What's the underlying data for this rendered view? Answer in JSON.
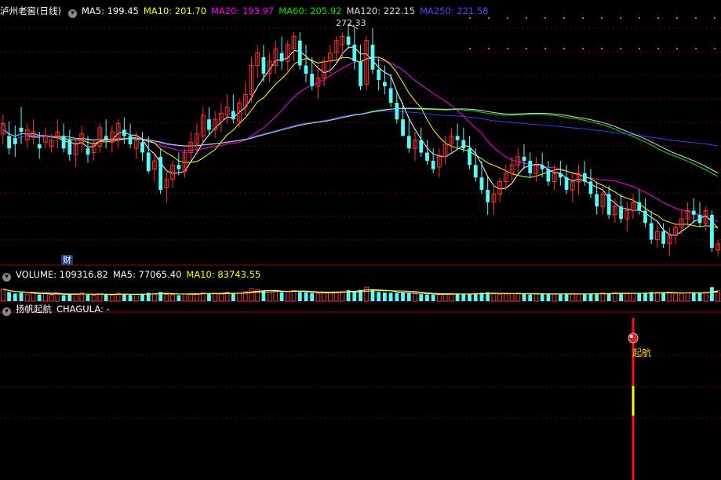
{
  "colors": {
    "up": "#ff3232",
    "down": "#54fcfc",
    "ma5": "#ffffff",
    "ma10": "#ffff00",
    "ma20": "#ff00ff",
    "ma60": "#00e600",
    "ma120": "#d8d8d8",
    "ma250": "#3a3aff",
    "grid": "#7a0000",
    "separator": "#b00000"
  },
  "price_header": {
    "title": "泸州老窖(日线)",
    "ma5": "MA5: 199.45",
    "ma10": "MA10: 201.70",
    "ma20": "MA20: 193.97",
    "ma60": "MA60: 205.92",
    "ma120": "MA120: 222.15",
    "ma250": "MA250: 221.58"
  },
  "high_label": "272.33",
  "finance_badge": "财",
  "volume_header": {
    "label": "VOLUME: 109316.82",
    "ma5": "MA5: 77065.40",
    "ma10": "MA10: 83743.55"
  },
  "indicator_header": {
    "label": "扬帆起航",
    "value": "CHAGULA: -"
  },
  "signal_label": "起航",
  "chart_data": {
    "type": "candlestick",
    "title": "泸州老窖(日线)",
    "price_range": [
      158,
      276
    ],
    "volume_range": [
      0,
      160000
    ],
    "grid": true,
    "candles_ohlc": [
      [
        219,
        228,
        214,
        224
      ],
      [
        218,
        225,
        209,
        212
      ],
      [
        217,
        223,
        208,
        214
      ],
      [
        222,
        232,
        214,
        220
      ],
      [
        216,
        224,
        212,
        221
      ],
      [
        218,
        226,
        214,
        220
      ],
      [
        214,
        220,
        207,
        212
      ],
      [
        215,
        222,
        212,
        218
      ],
      [
        213,
        219,
        210,
        216
      ],
      [
        217,
        226,
        212,
        220
      ],
      [
        218,
        224,
        210,
        212
      ],
      [
        216,
        221,
        206,
        209
      ],
      [
        209,
        217,
        203,
        214
      ],
      [
        215,
        223,
        210,
        219
      ],
      [
        212,
        218,
        205,
        209
      ],
      [
        210,
        216,
        206,
        214
      ],
      [
        213,
        224,
        210,
        222
      ],
      [
        218,
        226,
        212,
        216
      ],
      [
        215,
        223,
        210,
        220
      ],
      [
        216,
        226,
        212,
        224
      ],
      [
        221,
        227,
        214,
        218
      ],
      [
        218,
        224,
        212,
        214
      ],
      [
        212,
        220,
        207,
        216
      ],
      [
        215,
        220,
        206,
        210
      ],
      [
        210,
        218,
        200,
        201
      ],
      [
        202,
        209,
        196,
        206
      ],
      [
        208,
        212,
        190,
        192
      ],
      [
        193,
        202,
        186,
        197
      ],
      [
        197,
        206,
        193,
        204
      ],
      [
        204,
        210,
        199,
        202
      ],
      [
        201,
        212,
        198,
        210
      ],
      [
        210,
        220,
        206,
        215
      ],
      [
        214,
        224,
        209,
        219
      ],
      [
        218,
        232,
        215,
        228
      ],
      [
        226,
        232,
        218,
        221
      ],
      [
        221,
        230,
        217,
        226
      ],
      [
        225,
        234,
        220,
        229
      ],
      [
        228,
        238,
        224,
        232
      ],
      [
        230,
        238,
        224,
        226
      ],
      [
        225,
        236,
        222,
        234
      ],
      [
        232,
        244,
        228,
        238
      ],
      [
        238,
        256,
        234,
        252
      ],
      [
        252,
        262,
        246,
        258
      ],
      [
        256,
        262,
        244,
        248
      ],
      [
        248,
        258,
        244,
        254
      ],
      [
        252,
        264,
        248,
        260
      ],
      [
        258,
        266,
        250,
        254
      ],
      [
        254,
        264,
        248,
        262
      ],
      [
        260,
        268,
        254,
        266
      ],
      [
        264,
        268,
        250,
        252
      ],
      [
        252,
        262,
        244,
        248
      ],
      [
        248,
        256,
        240,
        242
      ],
      [
        242,
        252,
        236,
        246
      ],
      [
        246,
        256,
        242,
        254
      ],
      [
        254,
        262,
        248,
        258
      ],
      [
        258,
        266,
        252,
        264
      ],
      [
        262,
        268,
        256,
        266
      ],
      [
        266,
        272,
        260,
        262
      ],
      [
        262,
        270,
        250,
        254
      ],
      [
        254,
        262,
        240,
        242
      ],
      [
        243,
        266,
        240,
        264
      ],
      [
        262,
        270,
        248,
        250
      ],
      [
        250,
        256,
        240,
        245
      ],
      [
        244,
        252,
        238,
        242
      ],
      [
        241,
        248,
        232,
        234
      ],
      [
        234,
        240,
        224,
        226
      ],
      [
        226,
        234,
        218,
        218
      ],
      [
        218,
        226,
        210,
        212
      ],
      [
        212,
        220,
        206,
        216
      ],
      [
        216,
        222,
        208,
        210
      ],
      [
        210,
        216,
        204,
        206
      ],
      [
        206,
        212,
        200,
        202
      ],
      [
        203,
        212,
        198,
        208
      ],
      [
        208,
        218,
        204,
        214
      ],
      [
        214,
        222,
        210,
        218
      ],
      [
        218,
        224,
        212,
        216
      ],
      [
        216,
        222,
        210,
        212
      ],
      [
        212,
        218,
        202,
        204
      ],
      [
        204,
        212,
        196,
        198
      ],
      [
        198,
        206,
        190,
        192
      ],
      [
        192,
        198,
        180,
        186
      ],
      [
        186,
        194,
        180,
        190
      ],
      [
        190,
        198,
        186,
        196
      ],
      [
        196,
        204,
        192,
        200
      ],
      [
        200,
        208,
        196,
        204
      ],
      [
        204,
        212,
        200,
        208
      ],
      [
        208,
        214,
        202,
        206
      ],
      [
        206,
        210,
        198,
        200
      ],
      [
        200,
        208,
        196,
        204
      ],
      [
        204,
        210,
        198,
        202
      ],
      [
        202,
        206,
        194,
        196
      ],
      [
        196,
        204,
        192,
        200
      ],
      [
        200,
        206,
        194,
        198
      ],
      [
        198,
        204,
        190,
        192
      ],
      [
        192,
        200,
        186,
        196
      ],
      [
        196,
        204,
        190,
        200
      ],
      [
        200,
        206,
        194,
        196
      ],
      [
        196,
        202,
        188,
        190
      ],
      [
        190,
        196,
        180,
        184
      ],
      [
        184,
        194,
        180,
        190
      ],
      [
        190,
        194,
        178,
        180
      ],
      [
        180,
        188,
        176,
        184
      ],
      [
        184,
        190,
        176,
        178
      ],
      [
        178,
        186,
        172,
        182
      ],
      [
        182,
        190,
        178,
        186
      ],
      [
        186,
        192,
        180,
        182
      ],
      [
        182,
        188,
        174,
        176
      ],
      [
        176,
        182,
        166,
        168
      ],
      [
        168,
        176,
        164,
        172
      ],
      [
        172,
        176,
        164,
        166
      ],
      [
        166,
        174,
        160,
        170
      ],
      [
        170,
        176,
        166,
        174
      ],
      [
        174,
        182,
        170,
        178
      ],
      [
        178,
        186,
        174,
        182
      ],
      [
        182,
        188,
        176,
        180
      ],
      [
        180,
        186,
        174,
        176
      ],
      [
        176,
        184,
        172,
        182
      ],
      [
        180,
        182,
        162,
        164
      ],
      [
        163,
        168,
        160,
        166
      ]
    ],
    "volume": [
      95000,
      72000,
      60000,
      68000,
      55000,
      63000,
      52000,
      58000,
      49000,
      61000,
      47000,
      53000,
      56000,
      64000,
      50000,
      46000,
      58000,
      52000,
      49000,
      62000,
      55000,
      48000,
      51000,
      57000,
      66000,
      60000,
      72000,
      54000,
      50000,
      47000,
      56000,
      60000,
      58000,
      68000,
      63000,
      57000,
      62000,
      70000,
      59000,
      64000,
      75000,
      98000,
      92000,
      80000,
      74000,
      82000,
      70000,
      76000,
      84000,
      72000,
      68000,
      64000,
      60000,
      66000,
      71000,
      74000,
      78000,
      86000,
      80000,
      88000,
      110000,
      90000,
      72000,
      68000,
      66000,
      64000,
      70000,
      62000,
      58000,
      55000,
      52000,
      50000,
      54000,
      58000,
      60000,
      56000,
      53000,
      58000,
      62000,
      66000,
      70000,
      58000,
      54000,
      56000,
      60000,
      62000,
      57000,
      53000,
      55000,
      58000,
      60000,
      54000,
      52000,
      56000,
      60000,
      58000,
      55000,
      57000,
      62000,
      64000,
      60000,
      66000,
      62000,
      58000,
      61000,
      64000,
      66000,
      72000,
      68000,
      64000,
      70000,
      62000,
      60000,
      66000,
      68000,
      62000,
      70000,
      109316,
      82000
    ],
    "signal_index": 104
  }
}
